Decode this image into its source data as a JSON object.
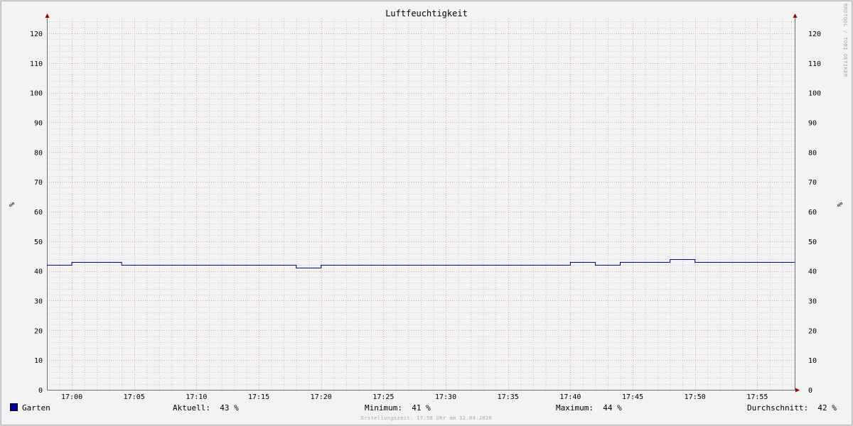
{
  "chart_data": {
    "type": "line",
    "title": "Luftfeuchtigkeit",
    "ylabel": "%",
    "ylabel_right": "%",
    "watermark": "RRDTOOL / TOBI OETIKER",
    "ylim": [
      0,
      125
    ],
    "yticks": [
      0,
      10,
      20,
      30,
      40,
      50,
      60,
      70,
      80,
      90,
      100,
      110,
      120
    ],
    "x_range_minutes": [
      -2,
      58
    ],
    "xticks": [
      {
        "m": 0,
        "label": "17:00"
      },
      {
        "m": 5,
        "label": "17:05"
      },
      {
        "m": 10,
        "label": "17:10"
      },
      {
        "m": 15,
        "label": "17:15"
      },
      {
        "m": 20,
        "label": "17:20"
      },
      {
        "m": 25,
        "label": "17:25"
      },
      {
        "m": 30,
        "label": "17:30"
      },
      {
        "m": 35,
        "label": "17:35"
      },
      {
        "m": 40,
        "label": "17:40"
      },
      {
        "m": 45,
        "label": "17:45"
      },
      {
        "m": 50,
        "label": "17:50"
      },
      {
        "m": 55,
        "label": "17:55"
      }
    ],
    "grid": true,
    "colors": {
      "series": "#00009c",
      "major_grid": "#e8a0a0",
      "minor_grid": "#c8c8c8",
      "axis": "#707070",
      "arrow": "#a00000"
    },
    "series": [
      {
        "name": "Garten",
        "x": [
          "16:58",
          "17:00",
          "17:04",
          "17:18",
          "17:20",
          "17:40",
          "17:42",
          "17:44",
          "17:48",
          "17:50",
          "17:58"
        ],
        "values": [
          42,
          43,
          42,
          41,
          42,
          43,
          42,
          43,
          44,
          43,
          43
        ]
      }
    ]
  },
  "legend": {
    "series_name": "Garten",
    "current": "Aktuell:  43 %",
    "min": "Minimum:  41 %",
    "max": "Maximum:  44 %",
    "avg": "Durchschnitt:  42 %"
  },
  "footer": "Erstellungszeit: 17:58 Uhr am 12.04.2026"
}
